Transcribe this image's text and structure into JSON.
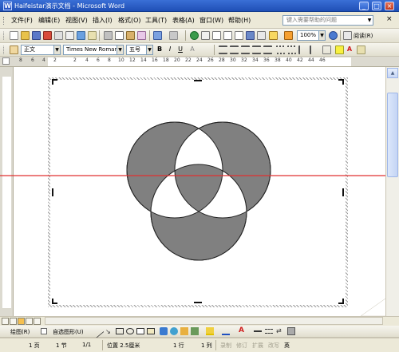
{
  "window": {
    "title": "Haifeistar演示文档 - Microsoft Word",
    "buttons": [
      "_",
      "□",
      "×"
    ]
  },
  "menu": {
    "items": [
      "文件(F)",
      "编辑(E)",
      "视图(V)",
      "插入(I)",
      "格式(O)",
      "工具(T)",
      "表格(A)",
      "窗口(W)",
      "帮助(H)"
    ],
    "help_placeholder": "键入需要帮助的问题",
    "close_doc": "×"
  },
  "standard_toolbar": {
    "zoom": "100%",
    "read_button": "阅读(R)"
  },
  "format_toolbar": {
    "style": "正文",
    "font": "Times New Roman",
    "size": "五号",
    "bold": "B",
    "italic": "I",
    "underline": "U",
    "char_A": "A",
    "font_color_A": "A"
  },
  "ruler": {
    "ticks": [
      "8",
      "6",
      "4",
      "2",
      "2",
      "4",
      "6",
      "8",
      "10",
      "12",
      "14",
      "16",
      "18",
      "20",
      "22",
      "24",
      "26",
      "28",
      "30",
      "32",
      "34",
      "36",
      "38",
      "40",
      "42",
      "44",
      "46"
    ]
  },
  "drawing_toolbar": {
    "draw_label": "绘图(R)",
    "autoshapes_label": "自选图形(U)"
  },
  "statusbar": {
    "page": "1 页",
    "section": "1 节",
    "page_of": "1/1",
    "position": "位置 2.5厘米",
    "line": "1 行",
    "column": "1 列",
    "rec": "录制",
    "trk": "修订",
    "ext": "扩展",
    "ovr": "改写",
    "lang": "英"
  },
  "colors": {
    "title_bar": "#2457c5",
    "circle_fill": "#808080",
    "red_line": "#e03030"
  }
}
